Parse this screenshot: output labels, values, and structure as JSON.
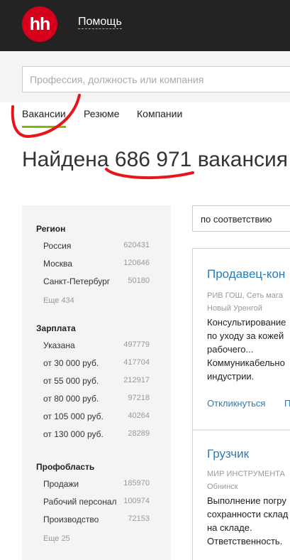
{
  "header": {
    "logo_text": "hh",
    "help_link": "Помощь"
  },
  "search": {
    "placeholder": "Профессия, должность или компания"
  },
  "tabs": [
    {
      "label": "Вакансии",
      "active": true
    },
    {
      "label": "Резюме",
      "active": false
    },
    {
      "label": "Компании",
      "active": false
    }
  ],
  "results": {
    "prefix": "Найдена",
    "count": "686 971",
    "suffix": "вакансия"
  },
  "filters": {
    "region": {
      "title": "Регион",
      "items": [
        {
          "label": "Россия",
          "count": "620431"
        },
        {
          "label": "Москва",
          "count": "120646"
        },
        {
          "label": "Санкт-Петербург",
          "count": "50180"
        }
      ],
      "more": "Еще 434"
    },
    "salary": {
      "title": "Зарплата",
      "items": [
        {
          "label": "Указана",
          "count": "497779"
        },
        {
          "label": "от 30 000 руб.",
          "count": "417704"
        },
        {
          "label": "от 55 000 руб.",
          "count": "212917"
        },
        {
          "label": "от 80 000 руб.",
          "count": "97218"
        },
        {
          "label": "от 105 000 руб.",
          "count": "40264"
        },
        {
          "label": "от 130 000 руб.",
          "count": "28289"
        }
      ]
    },
    "profarea": {
      "title": "Профобласть",
      "items": [
        {
          "label": "Продажи",
          "count": "185970"
        },
        {
          "label": "Рабочий персонал",
          "count": "100974"
        },
        {
          "label": "Производство",
          "count": "72153"
        }
      ],
      "more": "Еще 25"
    }
  },
  "sort": {
    "selected": "по соответствию"
  },
  "vacancies": [
    {
      "title": "Продавец-кон",
      "company": "РИВ ГОШ, Сеть мага",
      "city": "Новый Уренгой",
      "description": [
        "Консультирование",
        "по уходу за кожей",
        "рабочего...",
        "Коммуникабельно",
        "индустрии."
      ],
      "action": "Откликнуться",
      "action2": "П"
    },
    {
      "title": "Грузчик",
      "company": "МИР ИНСТРУМЕНТА",
      "city": "Обнинск",
      "description": [
        "Выполнение погру",
        "сохранности склад",
        "на складе.",
        "Ответственность."
      ]
    }
  ],
  "annotation_color": "#e8141b"
}
